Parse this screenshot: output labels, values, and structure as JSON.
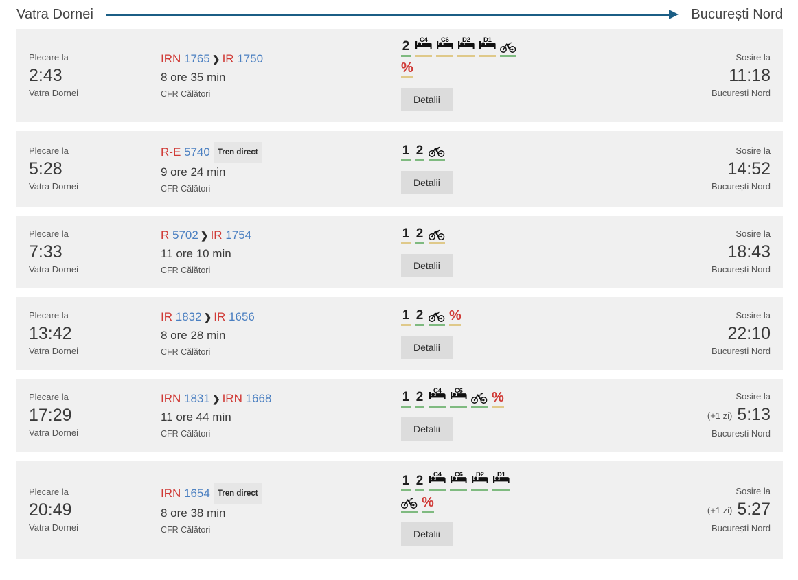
{
  "header": {
    "origin": "Vatra Dornei",
    "destination": "București Nord",
    "arrow_icon": "arrow-right-icon",
    "arrow_color": "#1b5e85"
  },
  "labels": {
    "depart_label": "Plecare la",
    "arrive_label": "Sosire la",
    "details_button": "Detalii",
    "direct_badge": "Tren direct",
    "next_day": "(+1 zi)"
  },
  "colors": {
    "row_background": "#f0f0f0",
    "train_code_red": "#d03a36",
    "train_number_blue": "#4a7fc1",
    "available_green": "#7fba80",
    "limited_yellow": "#dfc98a",
    "accent_blue": "#1b5e85"
  },
  "results": [
    {
      "depart_time": "2:43",
      "depart_station": "Vatra Dornei",
      "arrive_time": "11:18",
      "arrive_station": "București Nord",
      "arrive_next_day": "",
      "duration": "8 ore 35 min",
      "operator": "CFR Călători",
      "direct": false,
      "segments": [
        {
          "code": "IRN",
          "number": "1765"
        },
        {
          "code": "IR",
          "number": "1750"
        }
      ],
      "amenities": [
        {
          "type": "class",
          "label": "2",
          "status": "green"
        },
        {
          "type": "bed",
          "label": "C4",
          "status": "yellow"
        },
        {
          "type": "bed",
          "label": "C6",
          "status": "yellow"
        },
        {
          "type": "bed",
          "label": "D2",
          "status": "yellow"
        },
        {
          "type": "bed",
          "label": "D1",
          "status": "yellow"
        },
        {
          "type": "bike",
          "label": "",
          "status": "green"
        },
        {
          "type": "discount",
          "label": "%",
          "status": "yellow"
        }
      ]
    },
    {
      "depart_time": "5:28",
      "depart_station": "Vatra Dornei",
      "arrive_time": "14:52",
      "arrive_station": "București Nord",
      "arrive_next_day": "",
      "duration": "9 ore 24 min",
      "operator": "CFR Călători",
      "direct": true,
      "segments": [
        {
          "code": "R-E",
          "number": "5740"
        }
      ],
      "amenities": [
        {
          "type": "class",
          "label": "1",
          "status": "green"
        },
        {
          "type": "class",
          "label": "2",
          "status": "green"
        },
        {
          "type": "bike",
          "label": "",
          "status": "green"
        }
      ]
    },
    {
      "depart_time": "7:33",
      "depart_station": "Vatra Dornei",
      "arrive_time": "18:43",
      "arrive_station": "București Nord",
      "arrive_next_day": "",
      "duration": "11 ore 10 min",
      "operator": "CFR Călători",
      "direct": false,
      "segments": [
        {
          "code": "R",
          "number": "5702"
        },
        {
          "code": "IR",
          "number": "1754"
        }
      ],
      "amenities": [
        {
          "type": "class",
          "label": "1",
          "status": "yellow"
        },
        {
          "type": "class",
          "label": "2",
          "status": "green"
        },
        {
          "type": "bike",
          "label": "",
          "status": "yellow"
        }
      ]
    },
    {
      "depart_time": "13:42",
      "depart_station": "Vatra Dornei",
      "arrive_time": "22:10",
      "arrive_station": "București Nord",
      "arrive_next_day": "",
      "duration": "8 ore 28 min",
      "operator": "CFR Călători",
      "direct": false,
      "segments": [
        {
          "code": "IR",
          "number": "1832"
        },
        {
          "code": "IR",
          "number": "1656"
        }
      ],
      "amenities": [
        {
          "type": "class",
          "label": "1",
          "status": "yellow"
        },
        {
          "type": "class",
          "label": "2",
          "status": "green"
        },
        {
          "type": "bike",
          "label": "",
          "status": "green"
        },
        {
          "type": "discount",
          "label": "%",
          "status": "yellow"
        }
      ]
    },
    {
      "depart_time": "17:29",
      "depart_station": "Vatra Dornei",
      "arrive_time": "5:13",
      "arrive_station": "București Nord",
      "arrive_next_day": "(+1 zi)",
      "duration": "11 ore 44 min",
      "operator": "CFR Călători",
      "direct": false,
      "segments": [
        {
          "code": "IRN",
          "number": "1831"
        },
        {
          "code": "IRN",
          "number": "1668"
        }
      ],
      "amenities": [
        {
          "type": "class",
          "label": "1",
          "status": "green"
        },
        {
          "type": "class",
          "label": "2",
          "status": "green"
        },
        {
          "type": "bed",
          "label": "C4",
          "status": "green"
        },
        {
          "type": "bed",
          "label": "C6",
          "status": "green"
        },
        {
          "type": "bike",
          "label": "",
          "status": "green"
        },
        {
          "type": "discount",
          "label": "%",
          "status": "yellow"
        }
      ]
    },
    {
      "depart_time": "20:49",
      "depart_station": "Vatra Dornei",
      "arrive_time": "5:27",
      "arrive_station": "București Nord",
      "arrive_next_day": "(+1 zi)",
      "duration": "8 ore 38 min",
      "operator": "CFR Călători",
      "direct": true,
      "segments": [
        {
          "code": "IRN",
          "number": "1654"
        }
      ],
      "amenities": [
        {
          "type": "class",
          "label": "1",
          "status": "green"
        },
        {
          "type": "class",
          "label": "2",
          "status": "green"
        },
        {
          "type": "bed",
          "label": "C4",
          "status": "green"
        },
        {
          "type": "bed",
          "label": "C6",
          "status": "green"
        },
        {
          "type": "bed",
          "label": "D2",
          "status": "green"
        },
        {
          "type": "bed",
          "label": "D1",
          "status": "green"
        },
        {
          "type": "bike",
          "label": "",
          "status": "green"
        },
        {
          "type": "discount",
          "label": "%",
          "status": "green"
        }
      ]
    }
  ]
}
